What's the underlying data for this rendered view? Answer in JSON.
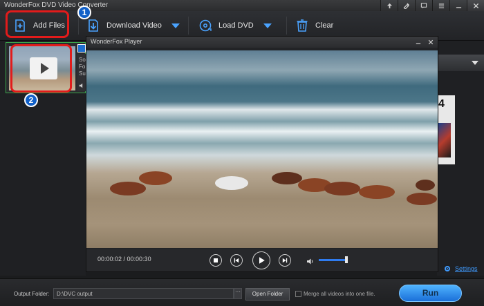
{
  "app": {
    "title": "WonderFox DVD Video Converter"
  },
  "titlebar": {
    "buttons": [
      "upload-icon",
      "tools-icon",
      "chat-icon",
      "menu-icon",
      "minimize-icon",
      "close-icon"
    ]
  },
  "toolbar": {
    "add_files_label": "Add Files",
    "download_video_label": "Download Video",
    "load_dvd_label": "Load DVD",
    "clear_label": "Clear"
  },
  "annotations": {
    "step1": "1",
    "step2": "2"
  },
  "file_item": {
    "side_lines": [
      "So",
      "Fo",
      "Su"
    ]
  },
  "player": {
    "title": "WonderFox Player",
    "time": "00:00:02 / 00:00:30",
    "volume_level": 0.95
  },
  "right_panel": {
    "settings_label": "Settings",
    "preview_text": "4"
  },
  "bottom": {
    "output_folder_label": "Output Folder:",
    "output_folder_value": "D:\\DVC output",
    "browse_label": "···",
    "open_folder_label": "Open Folder",
    "merge_label": "Merge all videos into one file.",
    "run_label": "Run"
  },
  "colors": {
    "accent_blue": "#1a6fd8",
    "highlight_red": "#e21b1b",
    "selection_green": "#3aa64b"
  }
}
